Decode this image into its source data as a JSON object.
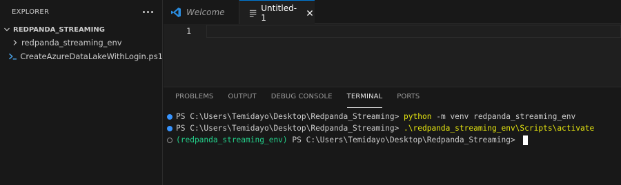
{
  "sidebar": {
    "title": "EXPLORER",
    "folder": "REDPANDA_STREAMING",
    "items": [
      {
        "label": "redpanda_streaming_env",
        "icon": "chevron-right-icon"
      },
      {
        "label": "CreateAzureDataLakeWithLogin.ps1",
        "icon": "powershell-icon"
      }
    ]
  },
  "tabs": [
    {
      "label": "Welcome",
      "icon": "vscode-logo-icon"
    },
    {
      "label": "Untitled-1",
      "icon": "file-lines-icon"
    }
  ],
  "editor": {
    "line_number": "1"
  },
  "panel": {
    "tabs": [
      "PROBLEMS",
      "OUTPUT",
      "DEBUG CONSOLE",
      "TERMINAL",
      "PORTS"
    ],
    "active_tab": "TERMINAL"
  },
  "terminal": {
    "lines": [
      {
        "prompt": "PS C:\\Users\\Temidayo\\Desktop\\Redpanda_Streaming> ",
        "cmd_main": "python",
        "cmd_rest": " -m venv redpanda_streaming_env"
      },
      {
        "prompt": "PS C:\\Users\\Temidayo\\Desktop\\Redpanda_Streaming> ",
        "cmd_main": ".\\redpanda_streaming_env\\Scripts\\activate"
      },
      {
        "env": "(redpanda_streaming_env)",
        "prompt": " PS C:\\Users\\Temidayo\\Desktop\\Redpanda_Streaming> "
      }
    ]
  },
  "colors": {
    "accent": "#0078d4",
    "terminal_dot": "#3794ff",
    "command": "#e5e510",
    "venv": "#23d18b"
  }
}
